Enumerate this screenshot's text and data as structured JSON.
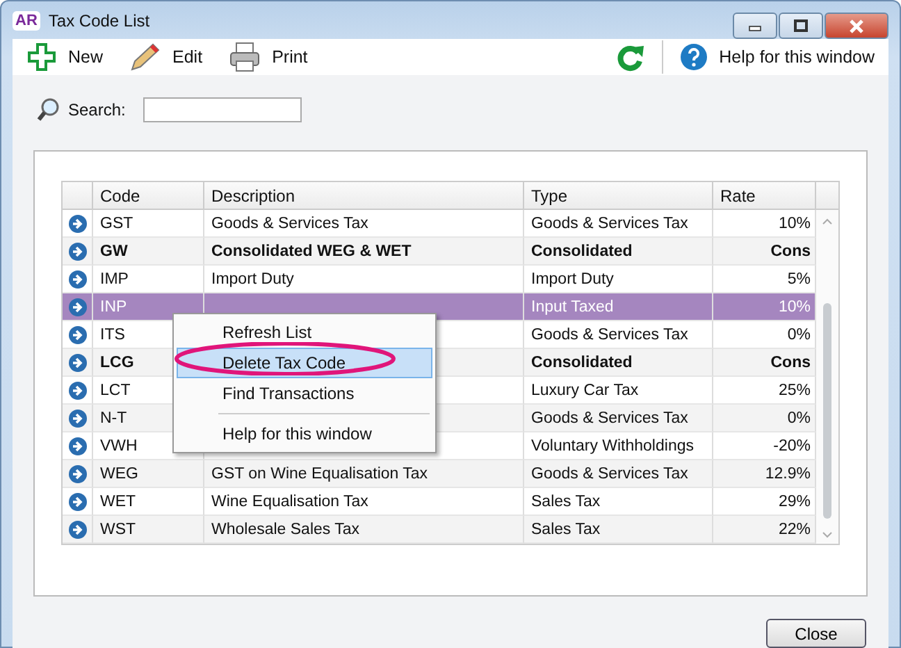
{
  "window": {
    "title": "Tax Code List",
    "app_badge": "AR"
  },
  "toolbar": {
    "left": [
      {
        "label": "New",
        "kind": "new"
      },
      {
        "label": "Edit",
        "kind": "edit"
      },
      {
        "label": "Print",
        "kind": "print"
      }
    ],
    "help": "Help for this window"
  },
  "search": {
    "label": "Search:"
  },
  "table": {
    "columns": [
      "Code",
      "Description",
      "Type",
      "Rate"
    ],
    "rows": [
      {
        "code": "GST",
        "description": "Goods & Services Tax",
        "type": "Goods & Services Tax",
        "rate": "10%",
        "kind": "single",
        "selected": false
      },
      {
        "code": "GW",
        "description": "Consolidated WEG & WET",
        "type": "Consolidated",
        "rate": "Cons",
        "kind": "consolidated",
        "selected": false
      },
      {
        "code": "IMP",
        "description": "Import Duty",
        "type": "Import Duty",
        "rate": "5%",
        "kind": "single",
        "selected": false
      },
      {
        "code": "INP",
        "type": "Input Taxed",
        "rate": "10%",
        "kind": "single",
        "selected": true
      },
      {
        "code": "ITS",
        "type": "Goods & Services Tax",
        "rate": "0%",
        "kind": "single",
        "selected": false
      },
      {
        "code": "LCG",
        "type": "Consolidated",
        "rate": "Cons",
        "kind": "consolidated",
        "selected": false
      },
      {
        "code": "LCT",
        "type": "Luxury Car Tax",
        "rate": "25%",
        "kind": "single",
        "selected": false
      },
      {
        "code": "N-T",
        "type": "Goods & Services Tax",
        "rate": "0%",
        "kind": "single",
        "selected": false
      },
      {
        "code": "VWH",
        "type": "Voluntary Withholdings",
        "rate": "-20%",
        "kind": "single",
        "selected": false
      },
      {
        "code": "WEG",
        "description": "GST on Wine Equalisation Tax",
        "type": "Goods & Services Tax",
        "rate": "12.9%",
        "kind": "single",
        "selected": false
      },
      {
        "code": "WET",
        "description": "Wine Equalisation Tax",
        "type": "Sales Tax",
        "rate": "29%",
        "kind": "single",
        "selected": false
      },
      {
        "code": "WST",
        "description": "Wholesale Sales Tax",
        "type": "Sales Tax",
        "rate": "22%",
        "kind": "single",
        "selected": false
      }
    ]
  },
  "context_menu": {
    "items": [
      {
        "label": "Refresh List",
        "kind": "item",
        "selected": false
      },
      {
        "label": "Delete Tax Code",
        "kind": "item",
        "selected": true
      },
      {
        "label": "Find Transactions",
        "kind": "item",
        "selected": false
      },
      {
        "kind": "separator"
      },
      {
        "label": "Help for this window",
        "kind": "item",
        "selected": false
      }
    ]
  },
  "buttons": [
    "Close"
  ]
}
